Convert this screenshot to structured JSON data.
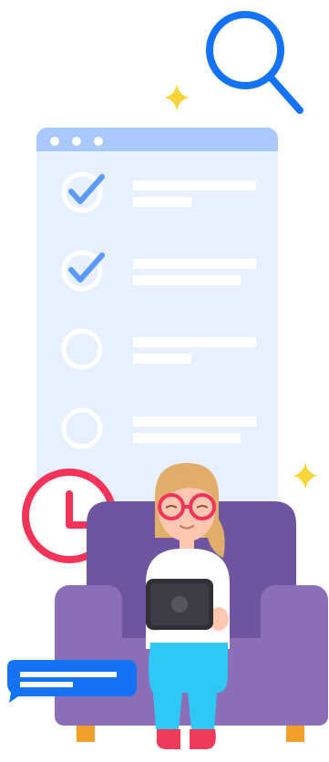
{
  "illustration": {
    "checklist": {
      "items": [
        {
          "checked": true
        },
        {
          "checked": true
        },
        {
          "checked": false
        },
        {
          "checked": false
        }
      ]
    },
    "icons": [
      "search-icon",
      "sparkle-icon",
      "sparkle-icon",
      "clock-icon",
      "chat-bubble-icon",
      "tablet-icon"
    ],
    "colors": {
      "accent_blue": "#1473f5",
      "window_bg": "#e6f0ff",
      "window_titlebar": "#a8c8ff",
      "check_blue": "#5b9bf6",
      "clock_red": "#f2335a",
      "sparkle_yellow": "#f7d43a",
      "armchair_purple": "#8a6fb8",
      "armchair_dark": "#6f55a0",
      "jeans_cyan": "#2ec8f5",
      "shoes_red": "#f03a5a"
    }
  }
}
